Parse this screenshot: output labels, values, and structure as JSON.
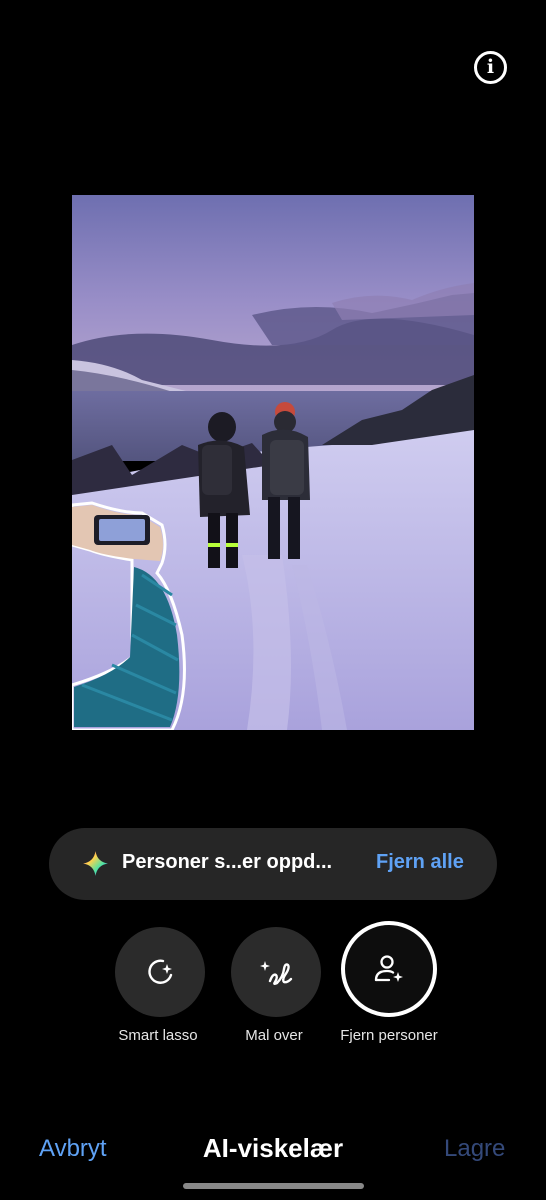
{
  "header": {
    "info_icon": "info-icon"
  },
  "suggestion": {
    "icon": "ai-sparkle-icon",
    "text": "Personer s...er oppd...",
    "action_label": "Fjern alle",
    "colors": {
      "background": "#262626",
      "action": "#5fa2f5"
    }
  },
  "tools": [
    {
      "label": "Smart lasso",
      "icon": "smart-lasso-icon",
      "selected": false
    },
    {
      "label": "Mal over",
      "icon": "draw-over-icon",
      "selected": false
    },
    {
      "label": "Fjern personer",
      "icon": "remove-people-icon",
      "selected": true
    }
  ],
  "footer": {
    "cancel_label": "Avbryt",
    "title": "AI-viskelær",
    "save_label": "Lagre",
    "colors": {
      "accent": "#5fa2f5",
      "disabled": "#34497a"
    }
  },
  "photo": {
    "description_icon": "edited-photo",
    "selection_outline_color": "#ffffff"
  }
}
